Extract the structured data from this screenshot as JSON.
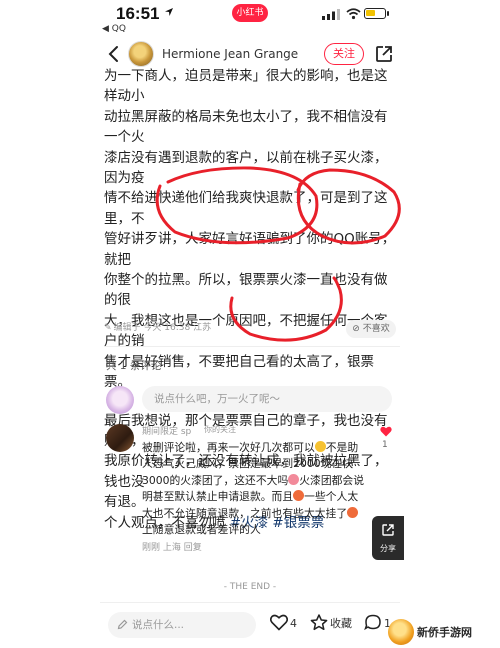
{
  "status_bar": {
    "time": "16:51",
    "back_app": "◀ QQ",
    "app_badge": "小红书"
  },
  "header": {
    "author": "Hermione Jean Grange",
    "follow_label": "关注"
  },
  "article": {
    "lines": [
      "为一下商人，迫员是带来」很大的影响，也是这样动小",
      "动拉黑屏蔽的格局未免也太小了，我不相信没有一个火",
      "漆店没有遇到退款的客户，以前在桃子买火漆，因为疫",
      "情不给进快递他们给我爽快退款了，可是到了这里，不",
      "管好讲歹讲，人家好言好语骗到了你的QQ账号，就把",
      "你整个的拉黑。所以，银票票火漆一直也没有做的很",
      "大，我想这也是一个原因吧，不把握任何一个客户的销",
      "售才是好销售，不要把自己看的太高了，银票票。"
    ],
    "lines2": [
      "最后我想说，那个是票票自己的章子，我也没有购件，",
      "我原价转让了，还没有转让成，我就被拉黑了，钱也没",
      "有退。"
    ],
    "closing": "个人观点，不喜勿喷",
    "tags": [
      "#火漆",
      "#银票票"
    ],
    "edited": "编辑于 今天 16:38 江苏",
    "dislike_label": "不喜欢"
  },
  "comments": {
    "count_label": "共 1 条评论",
    "input_placeholder": "说点什么吧，万一火了呢～",
    "items": [
      {
        "name": "期间限定 sp",
        "fav": "你的关注",
        "text_parts": [
          "被删评论啦，再来一次好几次都可以",
          "不是助人志气灭己威风，票团是最早到2000现在快3000的火漆团了，这还不大吗",
          "火漆团都会说明甚至默认禁止申请退款。而且",
          "一些个人太太也不允许随意退款，之前也有些太太挂了",
          "上随意退款或者差评的人"
        ],
        "likes": "1",
        "meta": "刚刚 上海 回复"
      }
    ]
  },
  "floating": {
    "share_label": "分享"
  },
  "end_label": "- THE END -",
  "bottom_bar": {
    "input_placeholder": "说点什么...",
    "likes": "4",
    "collect_label": "收藏",
    "comments": "1"
  },
  "watermark": {
    "text": "新侨手游网"
  },
  "colors": {
    "brand_red": "#ff2442",
    "tag_blue": "#13386c",
    "scribble_red": "#e8202a"
  }
}
